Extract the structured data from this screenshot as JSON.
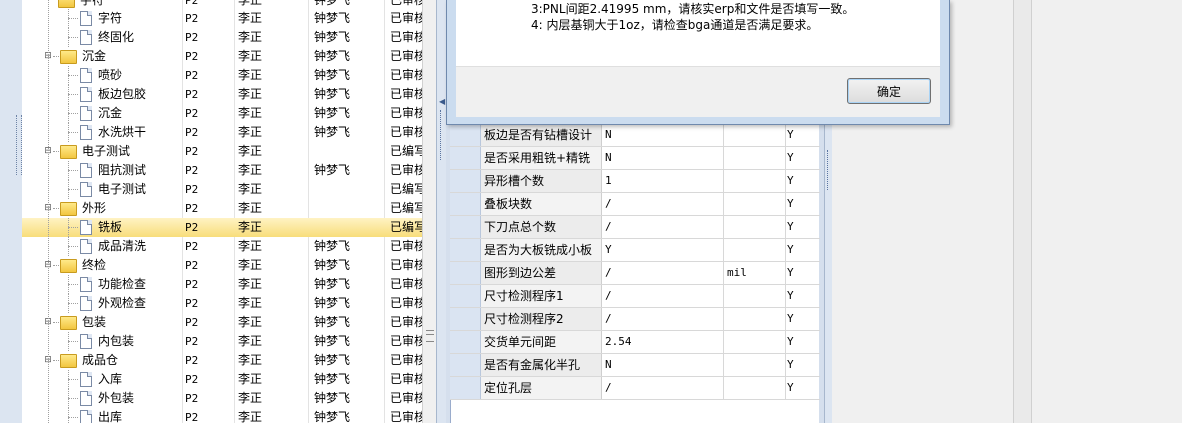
{
  "tree_rows": [
    {
      "name": "字符",
      "code": "P2",
      "p1": "李正",
      "p2": "钟梦飞",
      "status": "已审核",
      "level": 1,
      "kind": "doc"
    },
    {
      "name": "终固化",
      "code": "P2",
      "p1": "李正",
      "p2": "钟梦飞",
      "status": "已审核",
      "level": 1,
      "kind": "doc"
    },
    {
      "name": "沉金",
      "code": "P2",
      "p1": "李正",
      "p2": "钟梦飞",
      "status": "已审核",
      "level": 0,
      "kind": "folder"
    },
    {
      "name": "喷砂",
      "code": "P2",
      "p1": "李正",
      "p2": "钟梦飞",
      "status": "已审核",
      "level": 1,
      "kind": "doc"
    },
    {
      "name": "板边包胶",
      "code": "P2",
      "p1": "李正",
      "p2": "钟梦飞",
      "status": "已审核",
      "level": 1,
      "kind": "doc"
    },
    {
      "name": "沉金",
      "code": "P2",
      "p1": "李正",
      "p2": "钟梦飞",
      "status": "已审核",
      "level": 1,
      "kind": "doc"
    },
    {
      "name": "水洗烘干",
      "code": "P2",
      "p1": "李正",
      "p2": "钟梦飞",
      "status": "已审核",
      "level": 1,
      "kind": "doc"
    },
    {
      "name": "电子测试",
      "code": "P2",
      "p1": "李正",
      "p2": "",
      "status": "已编写",
      "level": 0,
      "kind": "folder"
    },
    {
      "name": "阻抗测试",
      "code": "P2",
      "p1": "李正",
      "p2": "钟梦飞",
      "status": "已审核",
      "level": 1,
      "kind": "doc"
    },
    {
      "name": "电子测试",
      "code": "P2",
      "p1": "李正",
      "p2": "",
      "status": "已编写",
      "level": 1,
      "kind": "doc"
    },
    {
      "name": "外形",
      "code": "P2",
      "p1": "李正",
      "p2": "",
      "status": "已编写",
      "level": 0,
      "kind": "folder"
    },
    {
      "name": "铣板",
      "code": "P2",
      "p1": "李正",
      "p2": "",
      "status": "已编写",
      "level": 1,
      "kind": "doc",
      "selected": true
    },
    {
      "name": "成品清洗",
      "code": "P2",
      "p1": "李正",
      "p2": "钟梦飞",
      "status": "已审核",
      "level": 1,
      "kind": "doc"
    },
    {
      "name": "终检",
      "code": "P2",
      "p1": "李正",
      "p2": "钟梦飞",
      "status": "已审核",
      "level": 0,
      "kind": "folder"
    },
    {
      "name": "功能检查",
      "code": "P2",
      "p1": "李正",
      "p2": "钟梦飞",
      "status": "已审核",
      "level": 1,
      "kind": "doc"
    },
    {
      "name": "外观检查",
      "code": "P2",
      "p1": "李正",
      "p2": "钟梦飞",
      "status": "已审核",
      "level": 1,
      "kind": "doc"
    },
    {
      "name": "包装",
      "code": "P2",
      "p1": "李正",
      "p2": "钟梦飞",
      "status": "已审核",
      "level": 0,
      "kind": "folder"
    },
    {
      "name": "内包装",
      "code": "P2",
      "p1": "李正",
      "p2": "钟梦飞",
      "status": "已审核",
      "level": 1,
      "kind": "doc"
    },
    {
      "name": "成品仓",
      "code": "P2",
      "p1": "李正",
      "p2": "钟梦飞",
      "status": "已审核",
      "level": 0,
      "kind": "folder"
    },
    {
      "name": "入库",
      "code": "P2",
      "p1": "李正",
      "p2": "钟梦飞",
      "status": "已审核",
      "level": 1,
      "kind": "doc"
    },
    {
      "name": "外包装",
      "code": "P2",
      "p1": "李正",
      "p2": "钟梦飞",
      "status": "已审核",
      "level": 1,
      "kind": "doc"
    },
    {
      "name": "出库",
      "code": "P2",
      "p1": "李正",
      "p2": "钟梦飞",
      "status": "已审核",
      "level": 1,
      "kind": "doc"
    }
  ],
  "tree_top_partial": {
    "name": "字符",
    "code": "P2",
    "p1": "李正",
    "p2": "钟梦飞",
    "status": "已审核"
  },
  "grid_rows": [
    {
      "name": "板边是否有钻槽设计",
      "value": "N",
      "unit": "",
      "flag": "Y"
    },
    {
      "name": "是否采用粗铣+精铣",
      "value": "N",
      "unit": "",
      "flag": "Y"
    },
    {
      "name": "异形槽个数",
      "value": "1",
      "unit": "",
      "flag": "Y"
    },
    {
      "name": "叠板块数",
      "value": "/",
      "unit": "",
      "flag": "Y"
    },
    {
      "name": "下刀点总个数",
      "value": "/",
      "unit": "",
      "flag": "Y"
    },
    {
      "name": "是否为大板铣成小板",
      "value": "Y",
      "unit": "",
      "flag": "Y"
    },
    {
      "name": "图形到边公差",
      "value": "/",
      "unit": "mil",
      "flag": "Y"
    },
    {
      "name": "尺寸检测程序1",
      "value": "/",
      "unit": "",
      "flag": "Y"
    },
    {
      "name": "尺寸检测程序2",
      "value": "/",
      "unit": "",
      "flag": "Y"
    },
    {
      "name": "交货单元间距",
      "value": "2.54",
      "unit": "",
      "flag": "Y"
    },
    {
      "name": "是否有金属化半孔",
      "value": "N",
      "unit": "",
      "flag": "Y"
    },
    {
      "name": "定位孔层",
      "value": "/",
      "unit": "",
      "flag": "Y"
    }
  ],
  "dialog": {
    "line3": "3:PNL间距2.41995 mm，请核实erp和文件是否填写一致。",
    "line4": "4: 内层基铜大于1oz，请检查bga通道是否满足要求。",
    "ok_label": "确定"
  },
  "colors": {
    "selected_row": "#fbe48c",
    "pane_bg": "#dce5f1",
    "dialog_frame": "#cbdcef"
  },
  "icons": [
    "folder-icon",
    "document-icon",
    "collapse-icon",
    "splitter-arrow-icon"
  ]
}
